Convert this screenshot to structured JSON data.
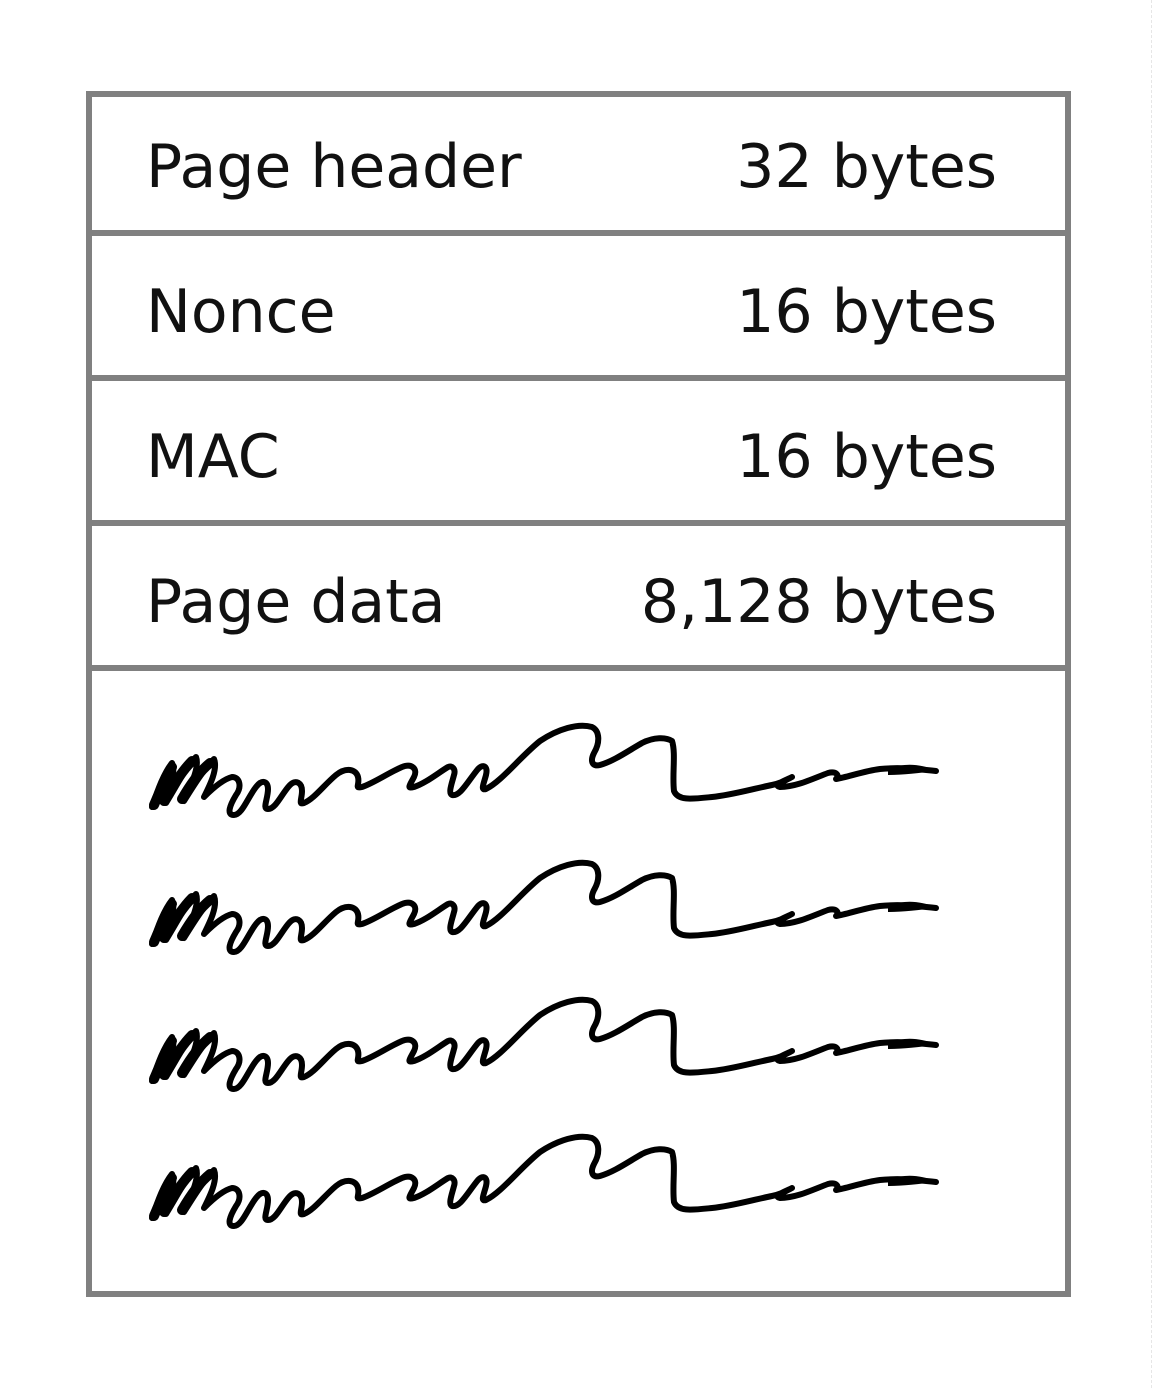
{
  "rows": [
    {
      "label": "Page header",
      "size": "32 bytes"
    },
    {
      "label": "Nonce",
      "size": "16 bytes"
    },
    {
      "label": "MAC",
      "size": "16 bytes"
    },
    {
      "label": "Page data",
      "size": "8,128 bytes"
    }
  ],
  "colors": {
    "border": "#808080",
    "text": "#111111",
    "scribble": "#000000"
  },
  "data_area": {
    "scribble_icon": "scribble-line-icon",
    "scribble_lines": 4
  }
}
